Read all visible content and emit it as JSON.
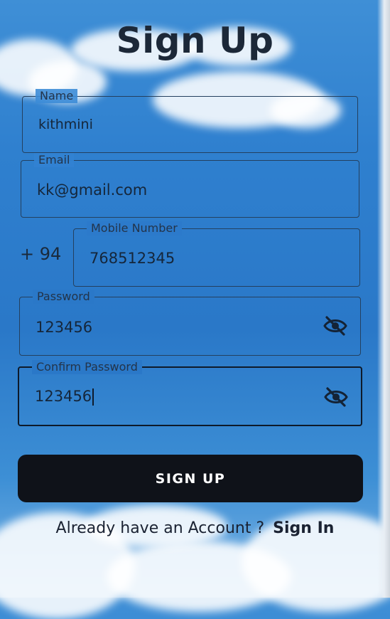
{
  "screen": {
    "title": "Sign Up"
  },
  "form": {
    "name": {
      "label": "Name",
      "value": "kithmini"
    },
    "email": {
      "label": "Email",
      "value": "kk@gmail.com"
    },
    "mobile": {
      "label": "Mobile Number",
      "prefix": "+ 94",
      "value": "768512345"
    },
    "password": {
      "label": "Password",
      "value": "123456",
      "toggle_icon": "eye-off-icon"
    },
    "confirm_password": {
      "label": "Confirm Password",
      "value": "123456",
      "toggle_icon": "eye-off-icon"
    }
  },
  "actions": {
    "signup_label": "SIGN UP",
    "account_prompt": "Already have an Account ?",
    "signin_label": "Sign In"
  },
  "colors": {
    "sky": "#2f80cf",
    "button_bg": "#0f1219",
    "button_text": "#ffffff",
    "text": "#1c2838"
  }
}
